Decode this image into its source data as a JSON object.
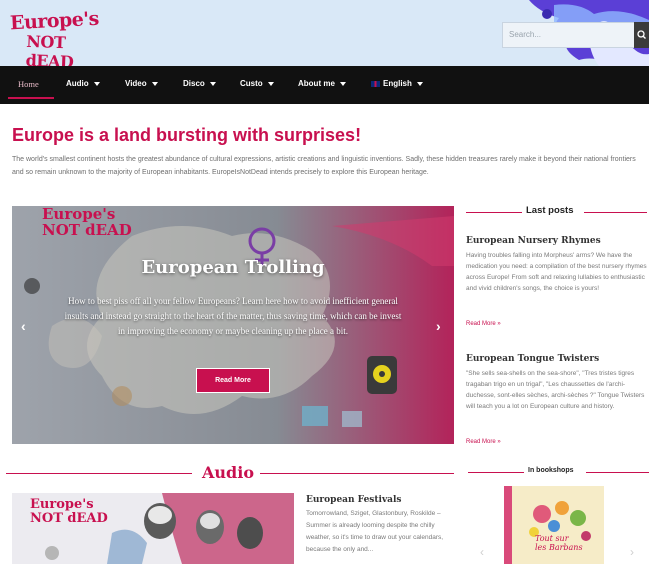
{
  "header": {
    "logo_line1": "Europe's",
    "logo_line2": "NOT dEAD",
    "search_placeholder": "Search..."
  },
  "nav": {
    "items": [
      {
        "label": "Home"
      },
      {
        "label": "Audio"
      },
      {
        "label": "Video"
      },
      {
        "label": "Disco"
      },
      {
        "label": "Custo"
      },
      {
        "label": "About me"
      },
      {
        "label": "English"
      }
    ]
  },
  "main": {
    "title": "Europe is a land bursting with surprises!",
    "intro": "The world's smallest continent hosts the greatest abundance of cultural expressions, artistic creations and linguistic inventions. Sadly, these hidden treasures rarely make it beyond their national frontiers and so remain unknown to the majority of European inhabitants. EuropeIsNotDead intends precisely to explore this European heritage."
  },
  "slider": {
    "logo_line1": "Europe's",
    "logo_line2": "NOT dEAD",
    "title": "European Trolling",
    "text": "How to best piss off all your fellow Europeans? Learn here how to avoid inefficient general insults and instead go straight to the heart of the matter, thus saving time, which can be invest in improving the economy or maybe cleaning up the place a bit.",
    "button": "Read More",
    "prev": "‹",
    "next": "›"
  },
  "sidebar": {
    "heading": "Last posts",
    "posts": [
      {
        "title": "European Nursery Rhymes",
        "excerpt": "Having troubles falling into Morpheus' arms? We have the medication you need: a compilation of the best nursery rhymes across Europe! From soft and relaxing lullabies to enthusiastic and vivid children's songs, the choice is yours!",
        "read_more": "Read More »"
      },
      {
        "title": "European Tongue Twisters",
        "excerpt": "\"She sells sea-shells on the sea-shore\", \"Tres tristes tigres tragaban trigo en un trigal\", \"Les chaussettes de l'archi-duchesse, sont-elles sèches, archi-sèches ?\" Tongue Twisters will teach you a lot on European culture and history.",
        "read_more": "Read More »"
      }
    ],
    "bookshops_heading": "In bookshops",
    "book_title_line1": "Tout sur",
    "book_title_line2": "les Barbans",
    "prev": "‹",
    "next": "›"
  },
  "audio": {
    "heading": "Audio",
    "logo_line1": "Europe's",
    "logo_line2": "NOT dEAD",
    "post_title": "European Festivals",
    "post_excerpt": "Tomorrowland, Sziget, Glastonbury, Roskilde – Summer is already looming despite the chilly weather, so it's time to draw out your calendars, because the only and..."
  },
  "colors": {
    "accent": "#c8104f",
    "nav_bg": "#111111",
    "header_bg": "#d9e8f7"
  }
}
